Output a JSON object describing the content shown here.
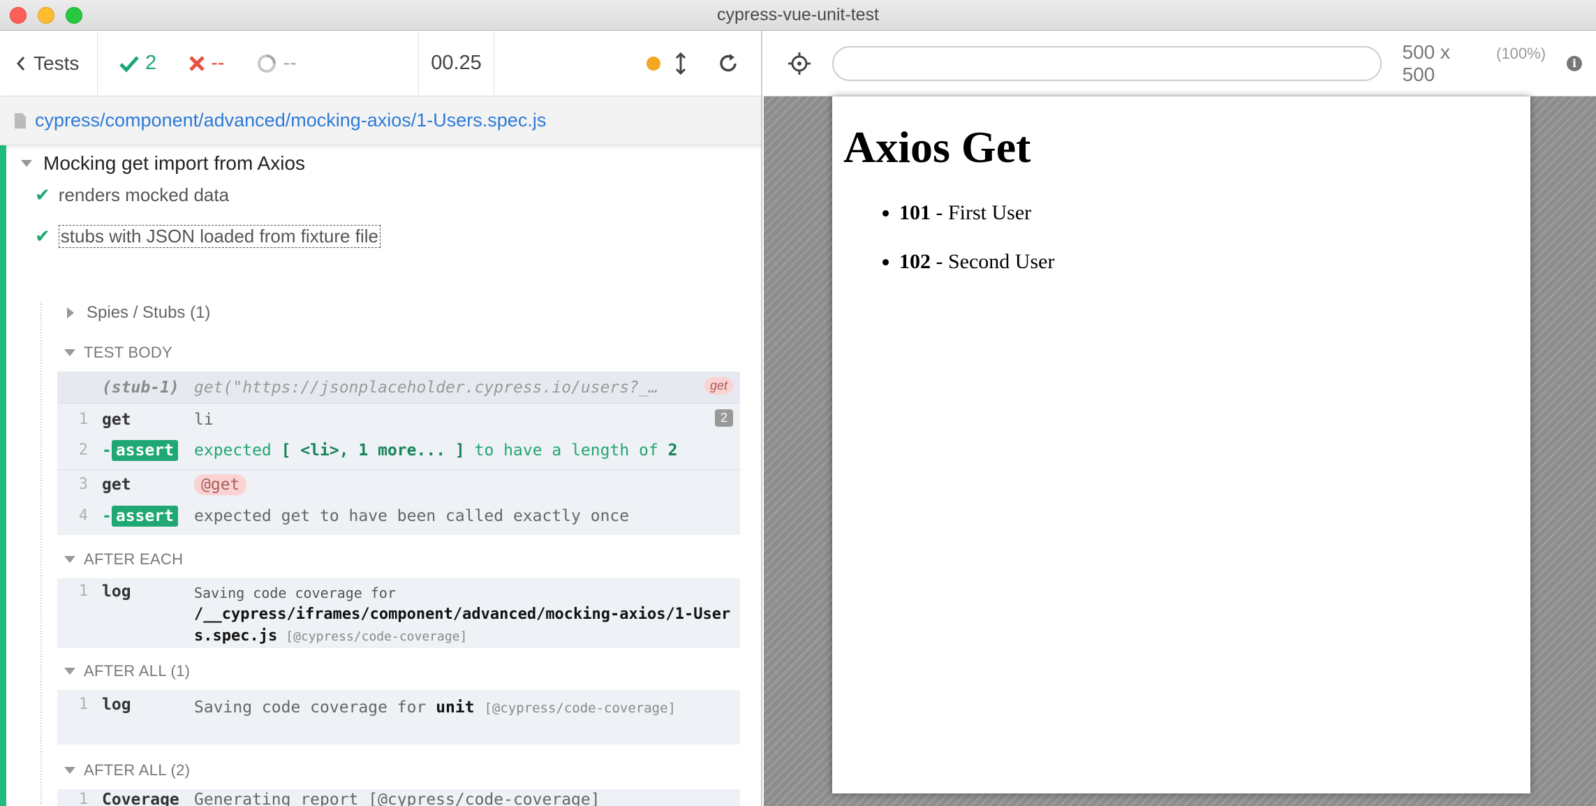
{
  "window": {
    "title": "cypress-vue-unit-test"
  },
  "reporter": {
    "back_label": "Tests",
    "passed": "2",
    "failed": "--",
    "pending": "--",
    "duration": "00.25",
    "spec_path": "cypress/component/advanced/mocking-axios/1-Users.spec.js",
    "suite_title": "Mocking get import from Axios",
    "tests": [
      {
        "title": "renders mocked data"
      },
      {
        "title": "stubs with JSON loaded from fixture file"
      }
    ],
    "spies_label": "Spies / Stubs (1)",
    "test_body_label": "TEST BODY",
    "stub": {
      "name": "(stub-1)",
      "msg": "get(\"https://jsonplaceholder.cypress.io/users?_…",
      "alias": "get"
    },
    "commands": [
      {
        "num": "1",
        "name": "get",
        "msg": "li",
        "count": "2"
      },
      {
        "num": "2",
        "name": "assert",
        "msg_a": "expected",
        "msg_b": "[ <li>, 1 more... ]",
        "msg_c": "to have a length of",
        "msg_d": "2"
      },
      {
        "num": "3",
        "name": "get",
        "alias": "@get"
      },
      {
        "num": "4",
        "name": "assert",
        "msg": "expected get to have been called exactly once"
      }
    ],
    "after_each_label": "AFTER EACH",
    "after_each_cmd": {
      "num": "1",
      "name": "log",
      "msg_a": "Saving code coverage for",
      "msg_b": "/__cypress/iframes/component/advanced/mocking-axios/1-Users.spec.js",
      "msg_c": "[@cypress/code-coverage]"
    },
    "after_all_1_label": "AFTER ALL (1)",
    "after_all_1_cmd": {
      "num": "1",
      "name": "log",
      "msg_a": "Saving code coverage for",
      "msg_b": "unit",
      "msg_c": "[@cypress/code-coverage]"
    },
    "after_all_2_label": "AFTER ALL (2)",
    "after_all_2_cmd": {
      "num": "1",
      "name": "Coverage",
      "msg": "Generating report [@cypress/code-coverage]"
    }
  },
  "preview": {
    "url": "",
    "viewport_size": "500 x 500",
    "viewport_pct": "(100%)",
    "app": {
      "heading": "Axios Get",
      "users": [
        {
          "id": "101",
          "name": "- First User"
        },
        {
          "id": "102",
          "name": "- Second User"
        }
      ]
    }
  },
  "colors": {
    "passed": "#1ea670",
    "failed": "#e94f3f",
    "link": "#2d7ad7",
    "suite_bar": "#1fbb7e",
    "running_dot": "#f5a623"
  }
}
